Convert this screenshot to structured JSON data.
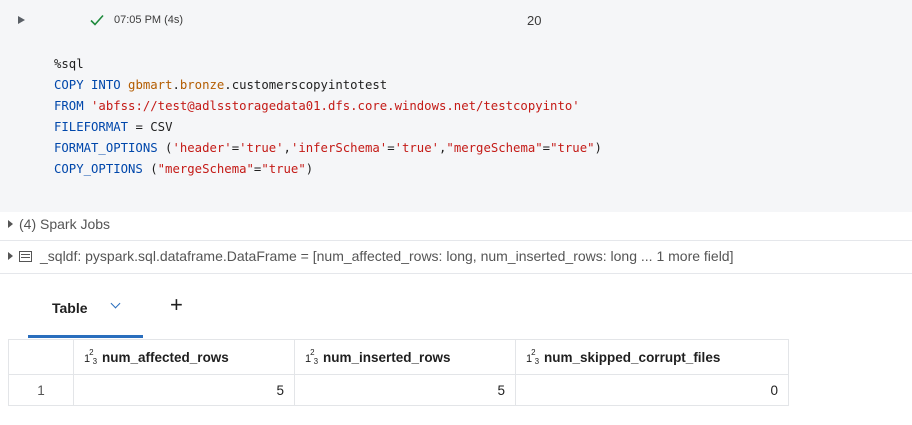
{
  "cell": {
    "status_time": "07:05 PM (4s)",
    "command_number": "20",
    "code_lines": [
      [
        {
          "t": "%sql",
          "c": ""
        }
      ],
      [
        {
          "t": "COPY INTO ",
          "c": "k"
        },
        {
          "t": "gbmart",
          "c": "g"
        },
        {
          "t": ".",
          "c": ""
        },
        {
          "t": "bronze",
          "c": "g"
        },
        {
          "t": ".customerscopyintotest",
          "c": ""
        }
      ],
      [
        {
          "t": "FROM ",
          "c": "k"
        },
        {
          "t": "'abfss://test@adlsstoragedata01.dfs.core.windows.net/testcopyinto'",
          "c": "s"
        }
      ],
      [
        {
          "t": "FILEFORMAT",
          "c": "k"
        },
        {
          "t": " = CSV",
          "c": ""
        }
      ],
      [
        {
          "t": "FORMAT_OPTIONS",
          "c": "k"
        },
        {
          "t": " (",
          "c": ""
        },
        {
          "t": "'header'",
          "c": "s"
        },
        {
          "t": "=",
          "c": ""
        },
        {
          "t": "'true'",
          "c": "s"
        },
        {
          "t": ",",
          "c": ""
        },
        {
          "t": "'inferSchema'",
          "c": "s"
        },
        {
          "t": "=",
          "c": ""
        },
        {
          "t": "'true'",
          "c": "s"
        },
        {
          "t": ",",
          "c": ""
        },
        {
          "t": "\"mergeSchema\"",
          "c": "s"
        },
        {
          "t": "=",
          "c": ""
        },
        {
          "t": "\"true\"",
          "c": "s"
        },
        {
          "t": ")",
          "c": ""
        }
      ],
      [
        {
          "t": "COPY_OPTIONS",
          "c": "k"
        },
        {
          "t": " (",
          "c": ""
        },
        {
          "t": "\"mergeSchema\"",
          "c": "s"
        },
        {
          "t": "=",
          "c": ""
        },
        {
          "t": "\"true\"",
          "c": "s"
        },
        {
          "t": ")",
          "c": ""
        }
      ]
    ],
    "spark_jobs": "(4) Spark Jobs",
    "dataframe_info": "_sqldf:  pyspark.sql.dataframe.DataFrame = [num_affected_rows: long, num_inserted_rows: long ... 1 more field]"
  },
  "result": {
    "tab_label": "Table",
    "add_tab": "+",
    "type_icon": {
      "base": "1",
      "sup": "2",
      "sub": "3"
    },
    "columns": [
      "num_affected_rows",
      "num_inserted_rows",
      "num_skipped_corrupt_files"
    ],
    "rows": [
      {
        "index": "1",
        "values": [
          "5",
          "5",
          "0"
        ]
      }
    ]
  },
  "colors": {
    "accent": "#2a6ebd",
    "keyword": "#0047ab",
    "string": "#c41a16",
    "identifier": "#b35c00",
    "success": "#1e8a3c"
  }
}
